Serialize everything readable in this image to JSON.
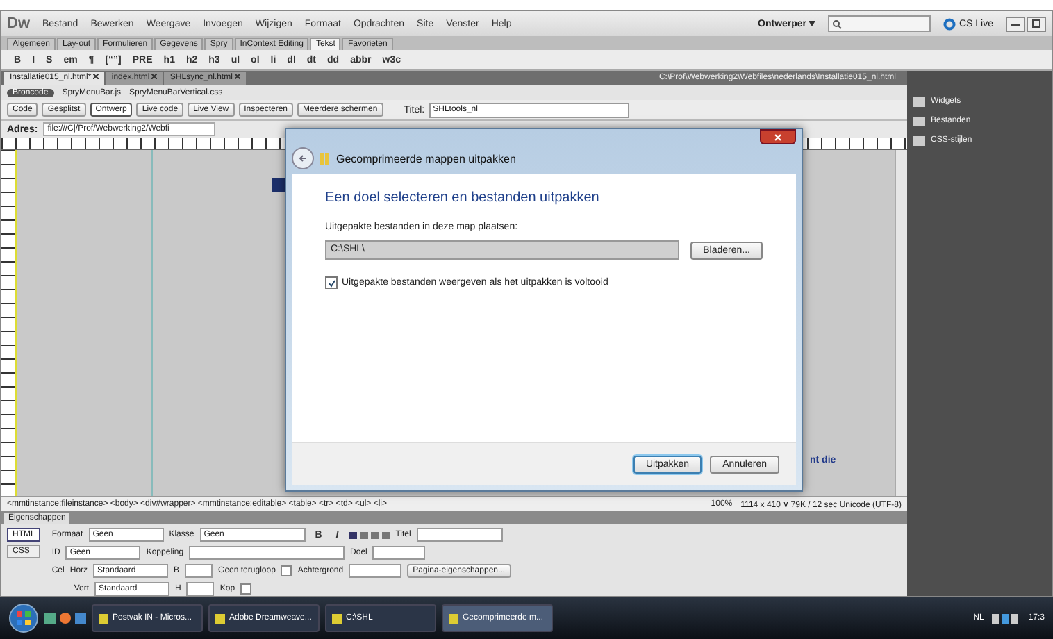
{
  "app": {
    "logo": "Dw",
    "menu": [
      "Bestand",
      "Bewerken",
      "Weergave",
      "Invoegen",
      "Wijzigen",
      "Formaat",
      "Opdrachten",
      "Site",
      "Venster",
      "Help"
    ],
    "workspace": "Ontwerper",
    "cs_live": "CS Live"
  },
  "insert_tabs": [
    {
      "label": "Algemeen",
      "selected": false
    },
    {
      "label": "Lay-out",
      "selected": false
    },
    {
      "label": "Formulieren",
      "selected": false
    },
    {
      "label": "Gegevens",
      "selected": false
    },
    {
      "label": "Spry",
      "selected": false
    },
    {
      "label": "InContext Editing",
      "selected": false
    },
    {
      "label": "Tekst",
      "selected": true
    },
    {
      "label": "Favorieten",
      "selected": false
    }
  ],
  "text_toolbar": [
    "B",
    "I",
    "S",
    "em",
    "¶",
    "[“”]",
    "PRE",
    "h1",
    "h2",
    "h3",
    "ul",
    "ol",
    "li",
    "dl",
    "dt",
    "dd",
    "abbr",
    "w3c"
  ],
  "document_tabs": [
    {
      "label": "Installatie015_nl.html*",
      "selected": true
    },
    {
      "label": "index.html",
      "selected": false
    },
    {
      "label": "SHLsync_nl.html",
      "selected": false
    }
  ],
  "document_path": "C:\\Prof\\Webwerking2\\Webfiles\\nederlands\\Installatie015_nl.html",
  "related_files": [
    {
      "label": "Broncode",
      "selected": true
    },
    {
      "label": "SpryMenuBar.js",
      "selected": false
    },
    {
      "label": "SpryMenuBarVertical.css",
      "selected": false
    }
  ],
  "view_buttons": [
    {
      "label": "Code",
      "selected": false
    },
    {
      "label": "Gesplitst",
      "selected": false
    },
    {
      "label": "Ontwerp",
      "selected": true
    }
  ],
  "tool_buttons": [
    "Live code",
    "Live View",
    "Inspecteren",
    "Meerdere schermen"
  ],
  "title_field": {
    "label": "Titel:",
    "value": "SHLtools_nl"
  },
  "address": {
    "label": "Adres:",
    "value": "file:///C|/Prof/Webwerking2/Webfi"
  },
  "design_fragments": [
    "nt die"
  ],
  "tag_selector": "<mmtinstance:fileinstance> <body> <div#wrapper> <mmtinstance:editable> <table> <tr> <td> <ul> <li>",
  "status": {
    "zoom": "100%",
    "info": "1114 x 410 ∨ 79K / 12 sec  Unicode (UTF-8)"
  },
  "panels": [
    {
      "label": "Widgets"
    },
    {
      "label": "Bestanden"
    },
    {
      "label": "CSS-stijlen"
    }
  ],
  "properties": {
    "title": "Eigenschappen",
    "modes": [
      {
        "label": "HTML",
        "selected": true
      },
      {
        "label": "CSS",
        "selected": false
      }
    ],
    "style_buttons": [
      "B",
      "I"
    ],
    "format": {
      "label": "Formaat",
      "value": "Geen"
    },
    "class": {
      "label": "Klasse",
      "value": "Geen"
    },
    "id": {
      "label": "ID",
      "value": "Geen"
    },
    "link": {
      "label": "Koppeling"
    },
    "title_attr": {
      "label": "Titel"
    },
    "target": {
      "label": "Doel"
    },
    "cell": "Cel",
    "horz": {
      "label": "Horz",
      "value": "Standaard"
    },
    "vert": {
      "label": "Vert",
      "value": "Standaard"
    },
    "width": {
      "label": "B"
    },
    "height": {
      "label": "H"
    },
    "nowrap": {
      "label": "Geen terugloop",
      "checked": false
    },
    "header": {
      "label": "Kop",
      "checked": false
    },
    "background": {
      "label": "Achtergrond"
    },
    "page_props": "Pagina-eigenschappen..."
  },
  "dialog": {
    "title": "Gecomprimeerde mappen uitpakken",
    "heading": "Een doel selecteren en bestanden uitpakken",
    "field_label": "Uitgepakte bestanden in deze map plaatsen:",
    "field_value": "C:\\SHL\\",
    "browse": "Bladeren...",
    "show_files": {
      "label": "Uitgepakte bestanden weergeven als het uitpakken is voltooid",
      "checked": true
    },
    "buttons": [
      {
        "label": "Uitpakken",
        "selected": true
      },
      {
        "label": "Annuleren",
        "selected": false
      }
    ]
  },
  "taskbar": {
    "items": [
      {
        "label": "Postvak IN - Micros...",
        "selected": false
      },
      {
        "label": "Adobe Dreamweave...",
        "selected": false
      },
      {
        "label": "C:\\SHL",
        "selected": false
      },
      {
        "label": "Gecomprimeerde m...",
        "selected": true
      }
    ],
    "language": "NL",
    "time": "17:3"
  }
}
